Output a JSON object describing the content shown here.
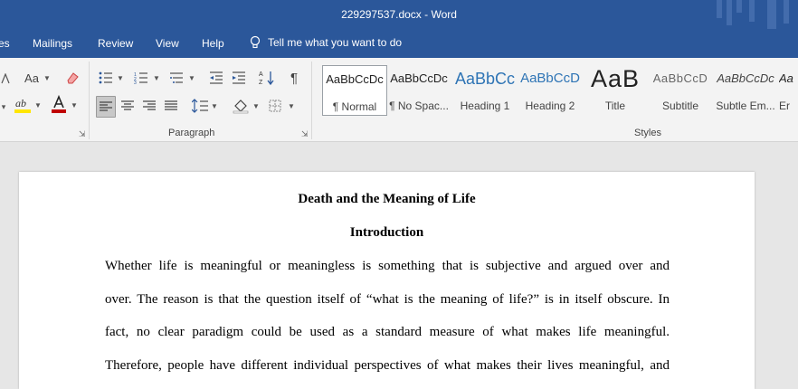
{
  "window": {
    "title": "229297537.docx  -  Word"
  },
  "menu": {
    "tabs": [
      "es",
      "Mailings",
      "Review",
      "View",
      "Help"
    ],
    "tell_me": "Tell me what you want to do"
  },
  "ribbon": {
    "paragraph_label": "Paragraph",
    "styles_label": "Styles",
    "font_aa": "Aa",
    "pilcrow": "¶",
    "styles": [
      {
        "sample": "AaBbCcDc",
        "name": "¶ Normal"
      },
      {
        "sample": "AaBbCcDc",
        "name": "¶ No Spac..."
      },
      {
        "sample": "AaBbCc",
        "name": "Heading 1"
      },
      {
        "sample": "AaBbCcD",
        "name": "Heading 2"
      },
      {
        "sample": "AaB",
        "name": "Title"
      },
      {
        "sample": "AaBbCcD",
        "name": "Subtitle"
      },
      {
        "sample": "AaBbCcDc",
        "name": "Subtle Em..."
      },
      {
        "sample": "Aa",
        "name": "Er"
      }
    ],
    "colors": {
      "highlight": "#ffe600",
      "font_color": "#c00000"
    }
  },
  "document": {
    "title": "Death and the Meaning of Life",
    "heading": "Introduction",
    "lines": [
      "Whether life is meaningful or meaningless is something that is subjective and argued over and",
      "over. The reason is that the question itself of “what is the meaning of life?” is in itself obscure. In",
      "fact, no clear paradigm could be used as a standard measure of what makes life meaningful.",
      "Therefore, people have different individual perspectives of what makes their lives meaningful, and"
    ]
  }
}
